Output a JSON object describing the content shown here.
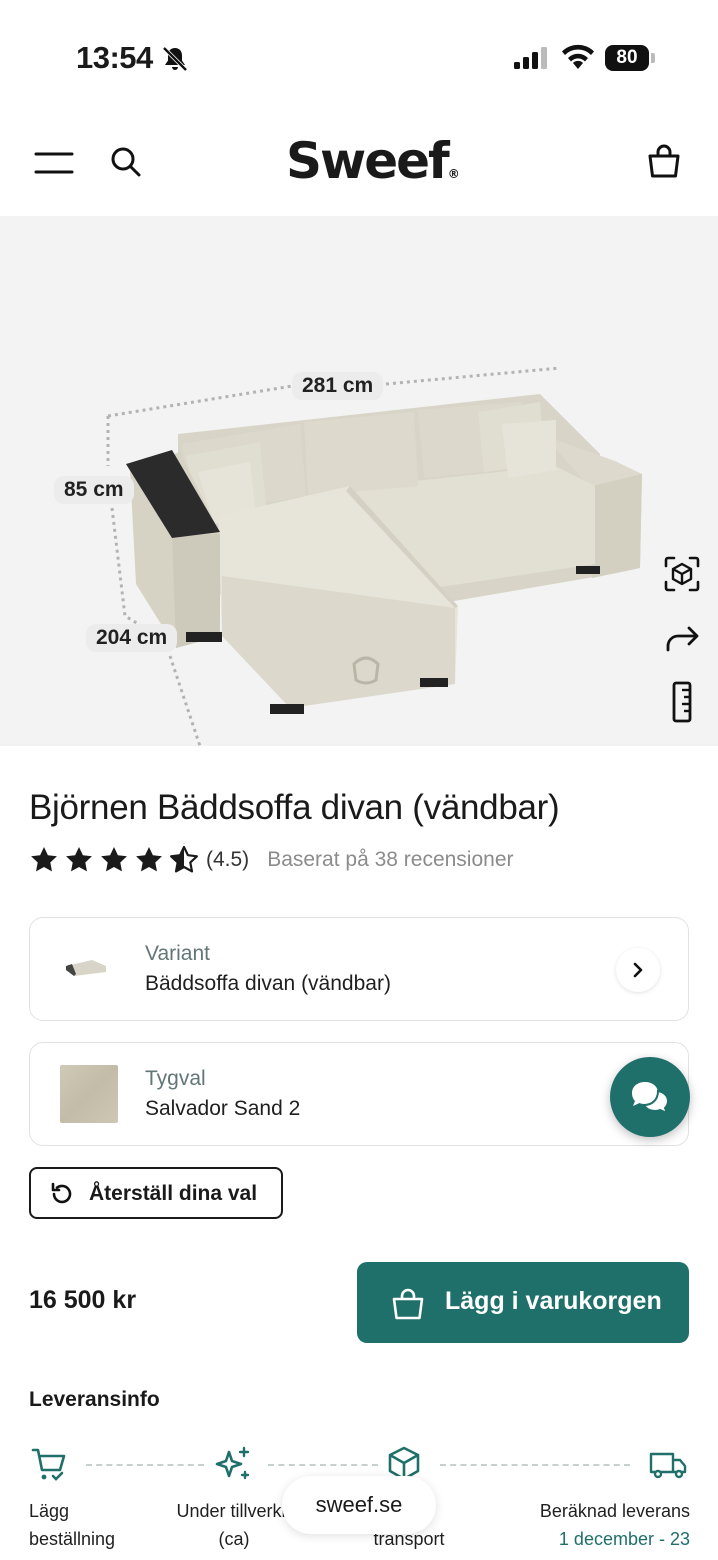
{
  "status_bar": {
    "time": "13:54",
    "battery": "80"
  },
  "header": {
    "logo": "Sweef",
    "logo_mark": "®"
  },
  "image": {
    "width_label": "281 cm",
    "height_label": "85 cm",
    "depth_label": "204 cm"
  },
  "product": {
    "title": "Björnen Bäddsoffa divan (vändbar)",
    "rating": 4.5,
    "rating_text": "(4.5)",
    "reviews_text": "Baserat på 38 recensioner"
  },
  "variant": {
    "label": "Variant",
    "value": "Bäddsoffa divan (vändbar)"
  },
  "fabric": {
    "label": "Tygval",
    "value": "Salvador Sand 2"
  },
  "reset": {
    "label": "Återställ dina val"
  },
  "purchase": {
    "price": "16 500 kr",
    "cart_label": "Lägg i varukorgen"
  },
  "delivery": {
    "title": "Leveransinfo",
    "steps": [
      {
        "line1": "Lägg",
        "line2": "beställning"
      },
      {
        "line1": "Under tillverkn",
        "line2": "(ca)"
      },
      {
        "line1": "&",
        "line2": "transport"
      },
      {
        "line1": "Beräknad leverans",
        "line2": "1 december - 23"
      }
    ]
  },
  "browser": {
    "url": "sweef.se"
  },
  "colors": {
    "brand": "#1f6f6a",
    "image_bg": "#f3f3f3",
    "fabric": "#cbc5b2"
  }
}
